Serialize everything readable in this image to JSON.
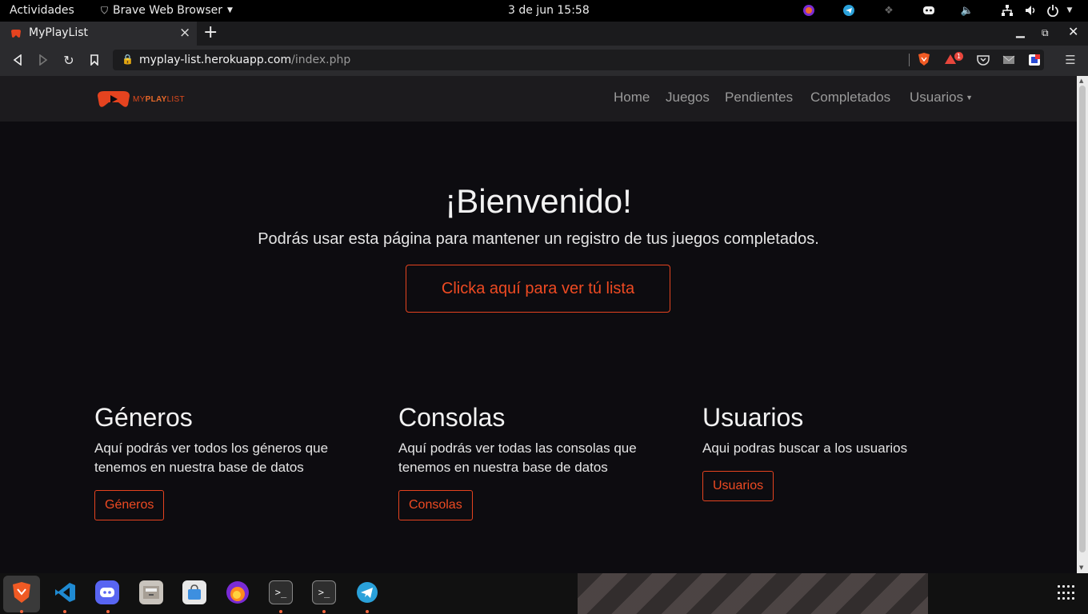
{
  "system_bar": {
    "activities": "Actividades",
    "app_name": "Brave Web Browser",
    "clock": "3 de jun  15:58"
  },
  "browser": {
    "tab_title": "MyPlayList",
    "url_host": "myplay-list.herokuapp.com",
    "url_path": "/index.php",
    "notification_count": "1"
  },
  "site": {
    "logo_prefix": "MY",
    "logo_bold": "PLAY",
    "logo_suffix": "LIST",
    "nav": [
      "Home",
      "Juegos",
      "Pendientes",
      "Completados",
      "Usuarios"
    ],
    "hero": {
      "title": "¡Bienvenido!",
      "subtitle": "Podrás usar esta página para mantener un registro de tus juegos completados.",
      "button": "Clicka aquí para ver tú lista"
    },
    "sections": [
      {
        "title": "Géneros",
        "line1": "Aquí podrás ver todos los géneros que",
        "line2": "tenemos en nuestra base de datos",
        "button": "Géneros"
      },
      {
        "title": "Consolas",
        "line1": "Aquí podrás ver todas las consolas que",
        "line2": "tenemos en nuestra base de datos",
        "button": "Consolas"
      },
      {
        "title": "Usuarios",
        "line1": "Aqui podras buscar a los usuarios",
        "line2": "",
        "button": "Usuarios"
      }
    ]
  },
  "colors": {
    "accent": "#e5431f",
    "page_bg": "#0d0c10",
    "navbar_bg": "#1c1b1e"
  },
  "dock_apps": [
    "brave-icon",
    "vscode-icon",
    "discord-icon",
    "files-icon",
    "software-icon",
    "firefox-icon",
    "terminal-icon",
    "terminal-icon",
    "telegram-icon"
  ]
}
